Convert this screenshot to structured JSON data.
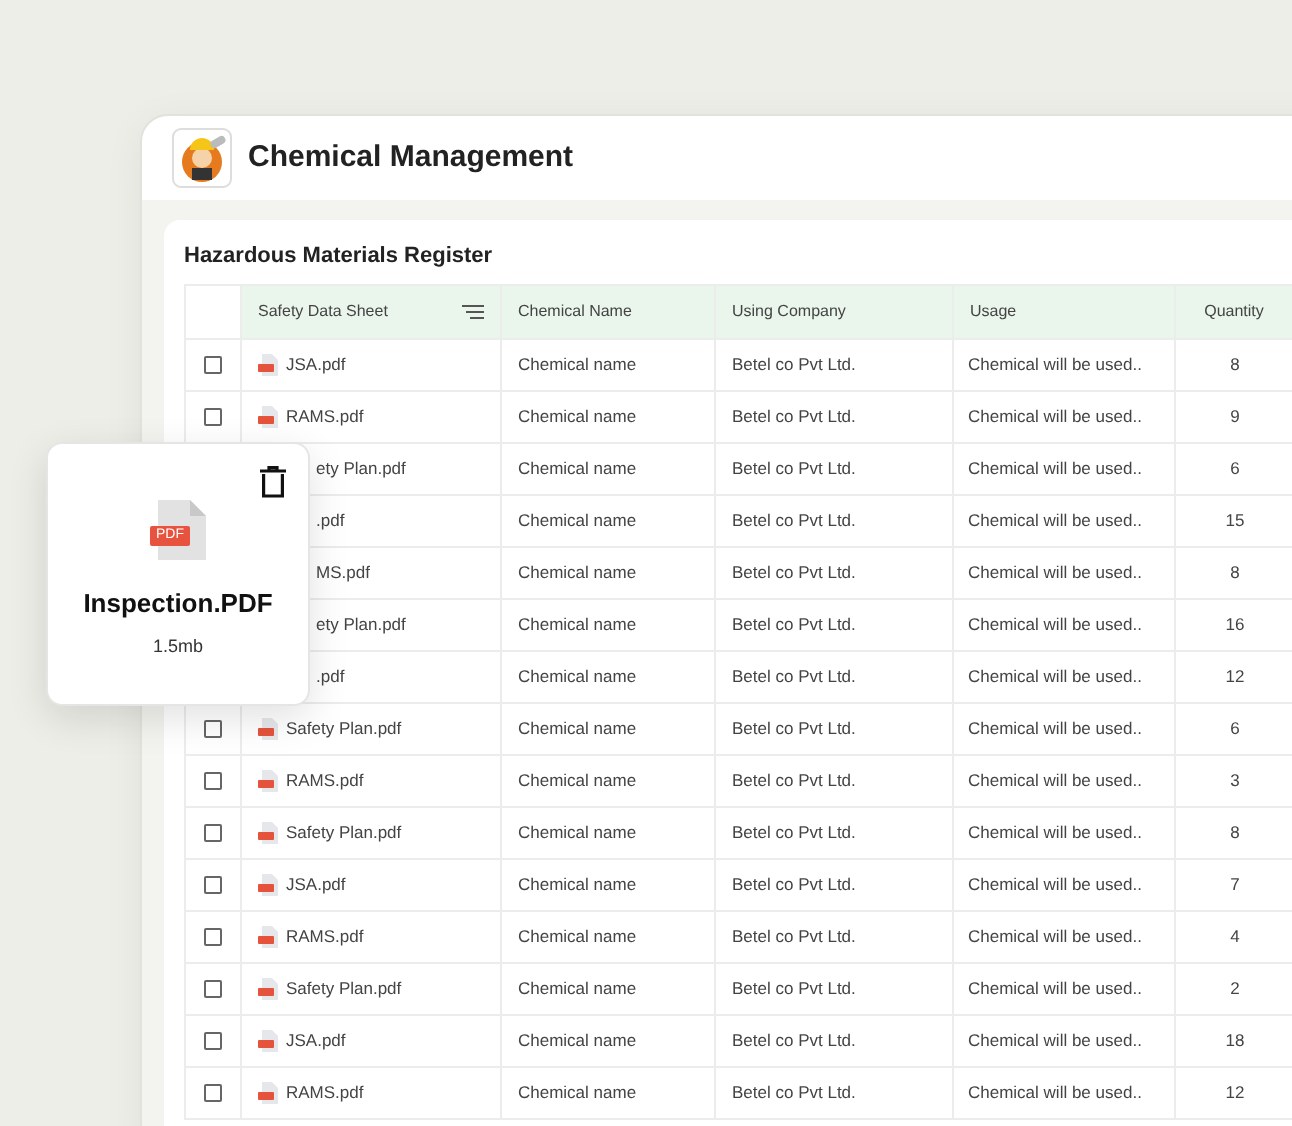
{
  "window": {
    "title": "Chemical Management"
  },
  "panel": {
    "title": "Hazardous Materials Register"
  },
  "table": {
    "columns": [
      "Safety Data Sheet",
      "Chemical Name",
      "Using Company",
      "Usage",
      "Quantity"
    ],
    "rows": [
      {
        "kind": "full",
        "checked": false,
        "file": "JSA.pdf",
        "name": "Chemical name",
        "company": "Betel co Pvt Ltd.",
        "usage": "Chemical will be used..",
        "quantity": "8"
      },
      {
        "kind": "full",
        "checked": false,
        "file": "RAMS.pdf",
        "name": "Chemical name",
        "company": "Betel co Pvt Ltd.",
        "usage": "Chemical will be used..",
        "quantity": "9"
      },
      {
        "kind": "covered",
        "file": "ety Plan.pdf",
        "name": "Chemical name",
        "company": "Betel co Pvt Ltd.",
        "usage": "Chemical will be used..",
        "quantity": "6"
      },
      {
        "kind": "covered",
        "file": ".pdf",
        "name": "Chemical name",
        "company": "Betel co Pvt Ltd.",
        "usage": "Chemical will be used..",
        "quantity": "15"
      },
      {
        "kind": "covered",
        "file": "MS.pdf",
        "name": "Chemical name",
        "company": "Betel co Pvt Ltd.",
        "usage": "Chemical will be used..",
        "quantity": "8"
      },
      {
        "kind": "covered",
        "file": "ety Plan.pdf",
        "name": "Chemical name",
        "company": "Betel co Pvt Ltd.",
        "usage": "Chemical will be used..",
        "quantity": "16"
      },
      {
        "kind": "covered",
        "file": ".pdf",
        "name": "Chemical name",
        "company": "Betel co Pvt Ltd.",
        "usage": "Chemical will be used..",
        "quantity": "12"
      },
      {
        "kind": "full",
        "checked": false,
        "file": "Safety Plan.pdf",
        "name": "Chemical name",
        "company": "Betel co Pvt Ltd.",
        "usage": "Chemical will be used..",
        "quantity": "6"
      },
      {
        "kind": "full",
        "checked": false,
        "file": "RAMS.pdf",
        "name": "Chemical name",
        "company": "Betel co Pvt Ltd.",
        "usage": "Chemical will be used..",
        "quantity": "3"
      },
      {
        "kind": "full",
        "checked": false,
        "file": "Safety Plan.pdf",
        "name": "Chemical name",
        "company": "Betel co Pvt Ltd.",
        "usage": "Chemical will be used..",
        "quantity": "8"
      },
      {
        "kind": "full",
        "checked": false,
        "file": "JSA.pdf",
        "name": "Chemical name",
        "company": "Betel co Pvt Ltd.",
        "usage": "Chemical will be used..",
        "quantity": "7"
      },
      {
        "kind": "full",
        "checked": false,
        "file": "RAMS.pdf",
        "name": "Chemical name",
        "company": "Betel co Pvt Ltd.",
        "usage": "Chemical will be used..",
        "quantity": "4"
      },
      {
        "kind": "full",
        "checked": false,
        "file": "Safety Plan.pdf",
        "name": "Chemical name",
        "company": "Betel co Pvt Ltd.",
        "usage": "Chemical will be used..",
        "quantity": "2"
      },
      {
        "kind": "full",
        "checked": false,
        "file": "JSA.pdf",
        "name": "Chemical name",
        "company": "Betel co Pvt Ltd.",
        "usage": "Chemical will be used..",
        "quantity": "18"
      },
      {
        "kind": "full",
        "checked": false,
        "file": "RAMS.pdf",
        "name": "Chemical name",
        "company": "Betel co Pvt Ltd.",
        "usage": "Chemical will be used..",
        "quantity": "12"
      }
    ]
  },
  "file_card": {
    "badge": "PDF",
    "filename": "Inspection.PDF",
    "size": "1.5mb"
  }
}
